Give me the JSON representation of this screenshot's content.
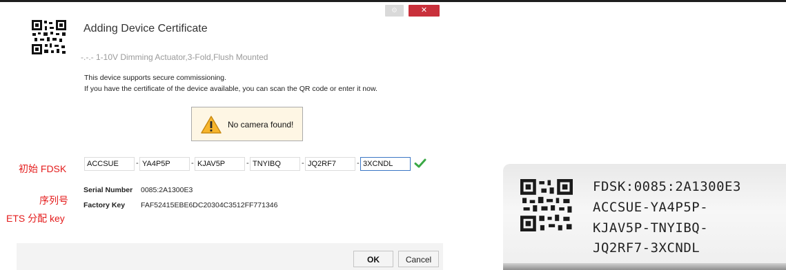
{
  "dialog": {
    "title": "Adding Device Certificate",
    "subtitle": "-.-.- 1-10V Dimming Actuator,3-Fold,Flush Mounted",
    "info_line1": "This device supports secure commissioning.",
    "info_line2": "If you have the certificate of the device available, you can scan the QR code or enter it now.",
    "camera_message": "No camera found!",
    "fdsk_segments": [
      "ACCSUE",
      "YA4P5P",
      "KJAV5P",
      "TNYIBQ",
      "JQ2RF7",
      "3XCNDL"
    ],
    "separator": "-",
    "serial_number_label": "Serial Number",
    "serial_number_value": "0085:2A1300E3",
    "factory_key_label": "Factory Key",
    "factory_key_value": "FAF52415EBE6DC20304C3512FF771346",
    "ok_label": "OK",
    "cancel_label": "Cancel",
    "window_controls": {
      "settings_glyph": "⚙",
      "close_glyph": "✕"
    },
    "icons": [
      "qr-code-icon",
      "warning-icon",
      "check-icon",
      "gear-icon",
      "close-icon"
    ]
  },
  "annotations": {
    "fdsk": "初始 FDSK",
    "serial": "序列号",
    "ets_key": "ETS 分配 key"
  },
  "label_photo": {
    "lines": [
      "FDSK:0085:2A1300E3",
      "ACCSUE-YA4P5P-",
      "KJAV5P-TNYIBQ-",
      "JQ2RF7-3XCNDL"
    ]
  },
  "colors": {
    "close_button": "#c9303b",
    "annotation_red": "#e41b1b",
    "check_green": "#3aa845",
    "camera_box_bg": "#fef6e4",
    "warning_yellow": "#f7b52c"
  }
}
